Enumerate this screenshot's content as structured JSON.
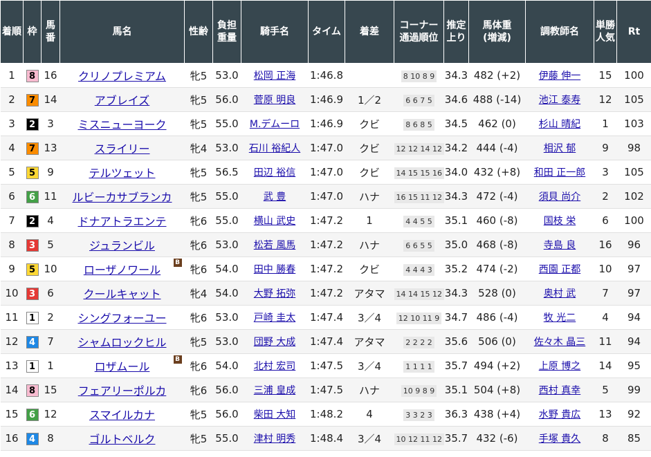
{
  "headers": {
    "finish": "着順",
    "waku": "枠",
    "horse_no": "馬番",
    "horse_name": "馬名",
    "sex_age": "性齢",
    "weight_carried": "負担重量",
    "jockey": "騎手名",
    "time": "タイム",
    "margin": "着差",
    "corner_line1": "コーナー",
    "corner_line2": "通過順位",
    "last3f": "推定上り",
    "body_weight_line1": "馬体重",
    "body_weight_line2": "(増減)",
    "trainer": "調教師名",
    "odds_rank": "単勝人気",
    "rating": "Rt"
  },
  "waku_colors": {
    "1": {
      "bg": "#ffffff",
      "fg": "#000000"
    },
    "2": {
      "bg": "#000000",
      "fg": "#ffffff"
    },
    "3": {
      "bg": "#e53935",
      "fg": "#ffffff"
    },
    "4": {
      "bg": "#1e88e5",
      "fg": "#ffffff"
    },
    "5": {
      "bg": "#fdd835",
      "fg": "#000000"
    },
    "6": {
      "bg": "#43a047",
      "fg": "#ffffff"
    },
    "7": {
      "bg": "#fb8c00",
      "fg": "#000000"
    },
    "8": {
      "bg": "#f8bbd0",
      "fg": "#000000"
    }
  },
  "rows": [
    {
      "finish": "1",
      "waku": "8",
      "horse_no": "16",
      "horse_name": "クリノプレミアム",
      "blinker": "",
      "sex_age": "牝5",
      "weight_carried": "53.0",
      "jockey": "松岡 正海",
      "time": "1:46.8",
      "margin": "",
      "corner": "8 10 8 9",
      "last3f": "34.3",
      "body_weight": "482 (+2)",
      "trainer": "伊藤 伸一",
      "odds_rank": "15",
      "rating": "100"
    },
    {
      "finish": "2",
      "waku": "7",
      "horse_no": "14",
      "horse_name": "アブレイズ",
      "blinker": "",
      "sex_age": "牝5",
      "weight_carried": "56.0",
      "jockey": "菅原 明良",
      "time": "1:46.9",
      "margin": "1／2",
      "corner": "6 6 7 5",
      "last3f": "34.6",
      "body_weight": "488 (-14)",
      "trainer": "池江 泰寿",
      "odds_rank": "12",
      "rating": "105"
    },
    {
      "finish": "3",
      "waku": "2",
      "horse_no": "3",
      "horse_name": "ミスニューヨーク",
      "blinker": "",
      "sex_age": "牝5",
      "weight_carried": "55.0",
      "jockey": "M.デムーロ",
      "time": "1:46.9",
      "margin": "クビ",
      "corner": "8 6 8 5",
      "last3f": "34.5",
      "body_weight": "462 (0)",
      "trainer": "杉山 晴紀",
      "odds_rank": "1",
      "rating": "103"
    },
    {
      "finish": "4",
      "waku": "7",
      "horse_no": "13",
      "horse_name": "スライリー",
      "blinker": "",
      "sex_age": "牝4",
      "weight_carried": "53.0",
      "jockey": "石川 裕紀人",
      "time": "1:47.0",
      "margin": "クビ",
      "corner": "12 12 14 12",
      "last3f": "34.2",
      "body_weight": "444 (-4)",
      "trainer": "相沢 郁",
      "odds_rank": "9",
      "rating": "98"
    },
    {
      "finish": "5",
      "waku": "5",
      "horse_no": "9",
      "horse_name": "テルツェット",
      "blinker": "",
      "sex_age": "牝5",
      "weight_carried": "56.5",
      "jockey": "田辺 裕信",
      "time": "1:47.0",
      "margin": "クビ",
      "corner": "14 15 15 16",
      "last3f": "34.0",
      "body_weight": "432 (+8)",
      "trainer": "和田 正一郎",
      "odds_rank": "3",
      "rating": "105"
    },
    {
      "finish": "6",
      "waku": "6",
      "horse_no": "11",
      "horse_name": "ルビーカサブランカ",
      "blinker": "",
      "sex_age": "牝5",
      "weight_carried": "55.0",
      "jockey": "武 豊",
      "time": "1:47.0",
      "margin": "ハナ",
      "corner": "16 15 11 12",
      "last3f": "34.3",
      "body_weight": "472 (-4)",
      "trainer": "須貝 尚介",
      "odds_rank": "2",
      "rating": "102"
    },
    {
      "finish": "7",
      "waku": "2",
      "horse_no": "4",
      "horse_name": "ドナアトラエンテ",
      "blinker": "",
      "sex_age": "牝6",
      "weight_carried": "55.0",
      "jockey": "横山 武史",
      "time": "1:47.2",
      "margin": "1",
      "corner": "4 4 5 5",
      "last3f": "35.1",
      "body_weight": "460 (-8)",
      "trainer": "国枝 栄",
      "odds_rank": "6",
      "rating": "100"
    },
    {
      "finish": "8",
      "waku": "3",
      "horse_no": "5",
      "horse_name": "ジュランビル",
      "blinker": "",
      "sex_age": "牝6",
      "weight_carried": "53.0",
      "jockey": "松若 風馬",
      "time": "1:47.2",
      "margin": "ハナ",
      "corner": "6 6 5 5",
      "last3f": "35.0",
      "body_weight": "468 (-8)",
      "trainer": "寺島 良",
      "odds_rank": "16",
      "rating": "96"
    },
    {
      "finish": "9",
      "waku": "5",
      "horse_no": "10",
      "horse_name": "ローザノワール",
      "blinker": "B",
      "sex_age": "牝6",
      "weight_carried": "54.0",
      "jockey": "田中 勝春",
      "time": "1:47.2",
      "margin": "クビ",
      "corner": "4 4 4 3",
      "last3f": "35.2",
      "body_weight": "474 (-2)",
      "trainer": "西園 正都",
      "odds_rank": "10",
      "rating": "97"
    },
    {
      "finish": "10",
      "waku": "3",
      "horse_no": "6",
      "horse_name": "クールキャット",
      "blinker": "",
      "sex_age": "牝4",
      "weight_carried": "54.0",
      "jockey": "大野 拓弥",
      "time": "1:47.2",
      "margin": "アタマ",
      "corner": "14 14 15 12",
      "last3f": "34.3",
      "body_weight": "528 (0)",
      "trainer": "奥村 武",
      "odds_rank": "7",
      "rating": "97"
    },
    {
      "finish": "11",
      "waku": "1",
      "horse_no": "2",
      "horse_name": "シングフォーユー",
      "blinker": "",
      "sex_age": "牝6",
      "weight_carried": "53.0",
      "jockey": "戸崎 圭太",
      "time": "1:47.4",
      "margin": "3／4",
      "corner": "12 10 11 9",
      "last3f": "34.7",
      "body_weight": "486 (-4)",
      "trainer": "牧 光二",
      "odds_rank": "4",
      "rating": "94"
    },
    {
      "finish": "12",
      "waku": "4",
      "horse_no": "7",
      "horse_name": "シャムロックヒル",
      "blinker": "",
      "sex_age": "牝5",
      "weight_carried": "53.0",
      "jockey": "団野 大成",
      "time": "1:47.4",
      "margin": "アタマ",
      "corner": "2 2 2 2",
      "last3f": "35.6",
      "body_weight": "506 (0)",
      "trainer": "佐々木 晶三",
      "odds_rank": "11",
      "rating": "94"
    },
    {
      "finish": "13",
      "waku": "1",
      "horse_no": "1",
      "horse_name": "ロザムール",
      "blinker": "B",
      "sex_age": "牝6",
      "weight_carried": "54.0",
      "jockey": "北村 宏司",
      "time": "1:47.5",
      "margin": "3／4",
      "corner": "1 1 1 1",
      "last3f": "35.7",
      "body_weight": "494 (+2)",
      "trainer": "上原 博之",
      "odds_rank": "14",
      "rating": "95"
    },
    {
      "finish": "14",
      "waku": "8",
      "horse_no": "15",
      "horse_name": "フェアリーポルカ",
      "blinker": "",
      "sex_age": "牝6",
      "weight_carried": "56.0",
      "jockey": "三浦 皇成",
      "time": "1:47.5",
      "margin": "ハナ",
      "corner": "10 9 8 9",
      "last3f": "35.1",
      "body_weight": "504 (+8)",
      "trainer": "西村 真幸",
      "odds_rank": "5",
      "rating": "99"
    },
    {
      "finish": "15",
      "waku": "6",
      "horse_no": "12",
      "horse_name": "スマイルカナ",
      "blinker": "",
      "sex_age": "牝5",
      "weight_carried": "56.0",
      "jockey": "柴田 大知",
      "time": "1:48.2",
      "margin": "4",
      "corner": "3 3 2 3",
      "last3f": "36.3",
      "body_weight": "438 (+4)",
      "trainer": "水野 貴広",
      "odds_rank": "13",
      "rating": "92"
    },
    {
      "finish": "16",
      "waku": "4",
      "horse_no": "8",
      "horse_name": "ゴルトベルク",
      "blinker": "",
      "sex_age": "牝5",
      "weight_carried": "55.0",
      "jockey": "津村 明秀",
      "time": "1:48.4",
      "margin": "3／4",
      "corner": "10 12 11 12",
      "last3f": "35.7",
      "body_weight": "432 (-6)",
      "trainer": "手塚 貴久",
      "odds_rank": "8",
      "rating": "85"
    }
  ]
}
